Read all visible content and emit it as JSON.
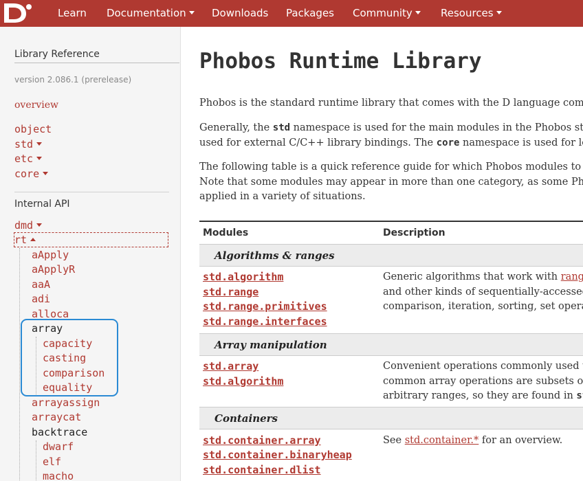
{
  "nav": {
    "items": [
      {
        "label": "Learn",
        "dropdown": false
      },
      {
        "label": "Documentation",
        "dropdown": true
      },
      {
        "label": "Downloads",
        "dropdown": false
      },
      {
        "label": "Packages",
        "dropdown": false
      },
      {
        "label": "Community",
        "dropdown": true
      },
      {
        "label": "Resources",
        "dropdown": true
      }
    ],
    "logo_icon": "d-logo-icon",
    "bar_color": "#b03931"
  },
  "sidebar": {
    "library_heading": "Library Reference",
    "version": "version 2.086.1 (prerelease)",
    "overview": "overview",
    "library_items": [
      "object",
      "std",
      "etc",
      "core"
    ],
    "internal_heading": "Internal API",
    "dmd": "dmd",
    "rt": "rt",
    "rt_children": [
      "aApply",
      "aApplyR",
      "aaA",
      "adi",
      "alloca"
    ],
    "array": "array",
    "array_children": [
      "capacity",
      "casting",
      "comparison",
      "equality"
    ],
    "after_array": [
      "arrayassign",
      "arraycat"
    ],
    "backtrace": "backtrace",
    "backtrace_children": [
      "dwarf",
      "elf",
      "macho"
    ],
    "highlight_color": "#2a8ad4"
  },
  "main": {
    "title": "Phobos Runtime Library",
    "p1": "Phobos is the standard runtime library that comes with the D language compi",
    "p2_a": "Generally, the ",
    "p2_code1": "std",
    "p2_b": " namespace is used for the main modules in the Phobos sta",
    "p2_c": "used for external C/C++ library bindings. The ",
    "p2_code2": "core",
    "p2_d": " namespace is used for low-",
    "p3_line1": "The following table is a quick reference guide for which Phobos modules to use",
    "p3_line2": "Note that some modules may appear in more than one category, as some Phob",
    "p3_line3": "applied in a variety of situations.",
    "table": {
      "col_modules": "Modules",
      "col_description": "Description",
      "sections": [
        {
          "category": "Algorithms & ranges",
          "modules": [
            "std.algorithm",
            "std.range",
            "std.range.primitives",
            "std.range.interfaces"
          ],
          "desc1_a": "Generic algorithms that work with ",
          "desc1_link": "range",
          "desc2": "and other kinds of sequentially-accessed",
          "desc3": "comparison, iteration, sorting, set operat"
        },
        {
          "category": "Array manipulation",
          "modules": [
            "std.array",
            "std.algorithm"
          ],
          "desc1": "Convenient operations commonly used w",
          "desc2": "common array operations are subsets of",
          "desc3_a": "arbitrary ranges, so they are found in ",
          "desc3_code": "std"
        },
        {
          "category": "Containers",
          "modules": [
            "std.container.array",
            "std.container.binaryheap",
            "std.container.dlist"
          ],
          "desc1_a": "See ",
          "desc1_link": "std.container.*",
          "desc1_b": " for an overview."
        }
      ]
    }
  }
}
